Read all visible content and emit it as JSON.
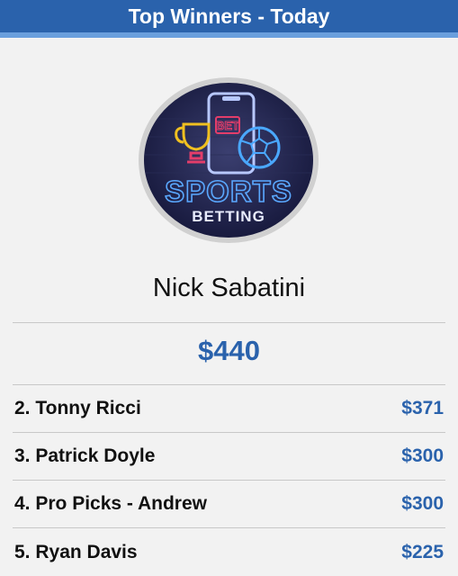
{
  "header": {
    "title": "Top Winners - Today"
  },
  "winner": {
    "avatar_icon": "sports-betting-logo",
    "avatar_text": {
      "top": "BET",
      "main": "SPORTS",
      "sub": "BETTING"
    },
    "name": "Nick Sabatini",
    "amount": "$440"
  },
  "leaders": [
    {
      "rank_name": "2. Tonny Ricci",
      "amount": "$371"
    },
    {
      "rank_name": "3. Patrick Doyle",
      "amount": "$300"
    },
    {
      "rank_name": "4. Pro Picks - Andrew",
      "amount": "$300"
    },
    {
      "rank_name": "5. Ryan Davis",
      "amount": "$225"
    }
  ],
  "colors": {
    "header_bg": "#2a62ac",
    "accent": "#2a62ac",
    "background": "#f2f2f2"
  }
}
